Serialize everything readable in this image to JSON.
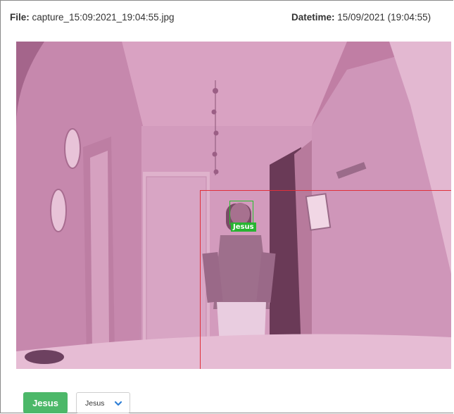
{
  "header": {
    "file_label": "File:",
    "file_name": "capture_15:09:2021_19:04:55.jpg",
    "datetime_label": "Datetime:",
    "datetime_value": "15/09/2021 (19:04:55)"
  },
  "image": {
    "detection": {
      "face_label": "Jesus",
      "box_color": "#e0303a",
      "face_box_color": "#22c22a"
    }
  },
  "controls": {
    "name_button": "Jesus",
    "name_select_value": "Jesus",
    "select_chevron_icon": "chevron-down-icon",
    "button_color": "#4cb869",
    "chevron_color": "#2f7fd6"
  }
}
